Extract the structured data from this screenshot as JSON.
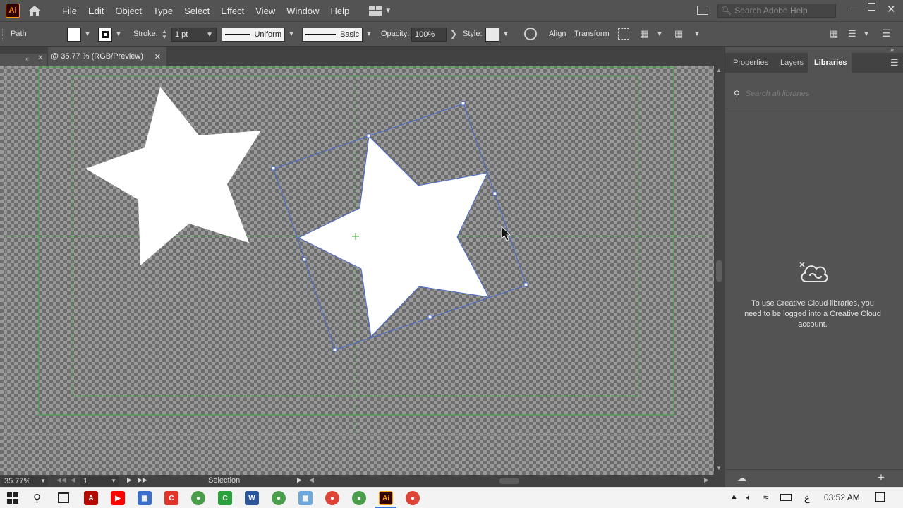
{
  "menubar": {
    "logo": "Ai",
    "items": [
      "File",
      "Edit",
      "Object",
      "Type",
      "Select",
      "Effect",
      "View",
      "Window",
      "Help"
    ],
    "search_placeholder": "Search Adobe Help"
  },
  "controlbar": {
    "selection_type": "Path",
    "stroke_label": "Stroke:",
    "stroke_weight": "1 pt",
    "stroke_profile": "Uniform",
    "brush": "Basic",
    "opacity_label": "Opacity:",
    "opacity_value": "100%",
    "style_label": "Style:",
    "align_label": "Align",
    "transform_label": "Transform"
  },
  "document": {
    "tab_title": "@ 35.77 % (RGB/Preview)"
  },
  "statusbar": {
    "zoom": "35.77%",
    "artboard": "1",
    "tool": "Selection"
  },
  "panel": {
    "tabs": [
      "Properties",
      "Layers",
      "Libraries"
    ],
    "active_tab": "Libraries",
    "search_placeholder": "Search all libraries",
    "message": "To use Creative Cloud libraries, you need to be logged into a Creative Cloud account."
  },
  "taskbar": {
    "time": "03:52 AM",
    "lang": "ع"
  },
  "colors": {
    "app_bg": "#535353",
    "selection_blue": "#4a6ccf",
    "guide_green": "#3ea83e",
    "ai_orange": "#ff9a00"
  }
}
